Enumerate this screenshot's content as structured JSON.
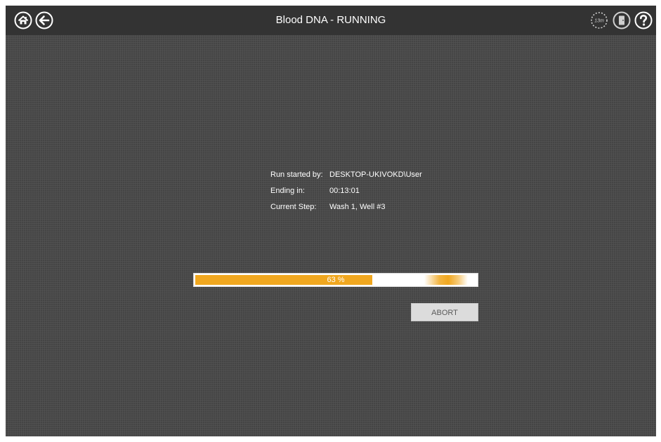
{
  "header": {
    "title": "Blood DNA - RUNNING",
    "timer_badge": "13m",
    "icons": [
      "home-icon",
      "back-arrow-icon",
      "timer-icon",
      "exit-door-icon",
      "help-icon"
    ]
  },
  "run_info": {
    "rows": [
      {
        "label": "Run started by:",
        "value": "DESKTOP-UKIVOKD\\User"
      },
      {
        "label": "Ending in:",
        "value": "00:13:01"
      },
      {
        "label": "Current Step:",
        "value": "Wash 1, Well #3"
      }
    ]
  },
  "progress": {
    "percent": 63,
    "label": "63 %",
    "fill_color": "#f0a71f"
  },
  "actions": {
    "abort_label": "ABORT"
  },
  "colors": {
    "background": "#4a4a4a",
    "topbar": "#333333",
    "accent": "#f0a71f"
  }
}
